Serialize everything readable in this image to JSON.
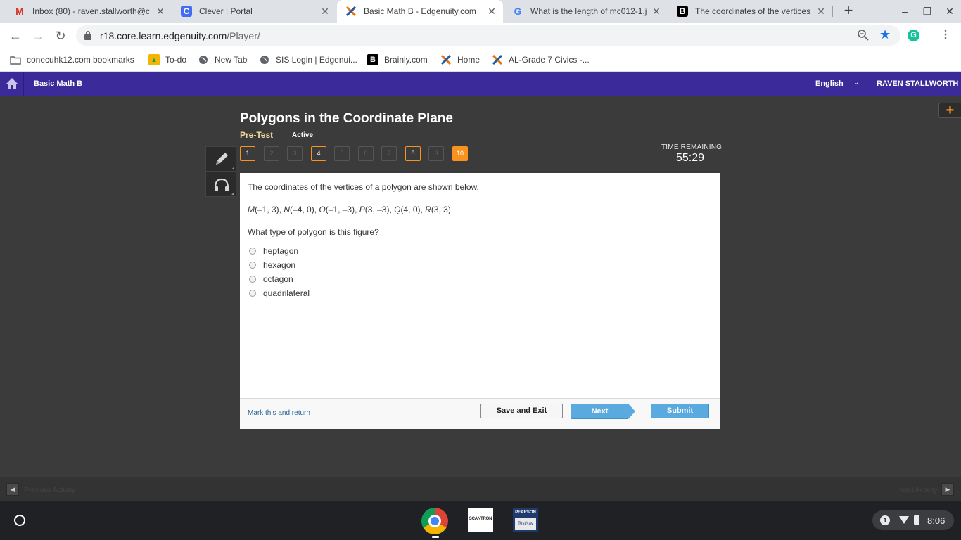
{
  "browser": {
    "tabs": [
      {
        "title": "Inbox (80) - raven.stallworth@c",
        "favicon": "gmail-icon",
        "color": "#d93025",
        "active": false
      },
      {
        "title": "Clever | Portal",
        "favicon": "clever-icon",
        "color": "#436cf2",
        "active": false
      },
      {
        "title": "Basic Math B - Edgenuity.com",
        "favicon": "edgenuity-icon",
        "color": "#e8710a",
        "active": true
      },
      {
        "title": "What is the length of mc012-1.j",
        "favicon": "google-icon",
        "color": "#4285f4",
        "active": false
      },
      {
        "title": "The coordinates of the vertices c",
        "favicon": "brainly-icon",
        "color": "#000000",
        "active": false
      }
    ],
    "url_host": "r18.core.learn.edgenuity.com",
    "url_path": "/Player/",
    "bookmarks": [
      {
        "label": "conecuhk12.com bookmarks",
        "icon": "folder-icon"
      },
      {
        "label": "To-do",
        "icon": "todo-icon"
      },
      {
        "label": "New Tab",
        "icon": "globe-icon"
      },
      {
        "label": "SIS Login | Edgenui...",
        "icon": "globe-icon"
      },
      {
        "label": "Brainly.com",
        "icon": "brainly-icon"
      },
      {
        "label": "Home",
        "icon": "edgenuity-icon"
      },
      {
        "label": "AL-Grade 7 Civics -...",
        "icon": "edgenuity-icon"
      }
    ]
  },
  "header": {
    "course": "Basic Math B",
    "language": "English",
    "user": "RAVEN STALLWORTH",
    "bg_color": "#3b2a99"
  },
  "lesson": {
    "title": "Polygons in the Coordinate Plane",
    "activity_type": "Pre-Test",
    "status": "Active",
    "timer_label": "TIME REMAINING",
    "timer": "55:29"
  },
  "question_nav": [
    {
      "label": "1",
      "state": "answered"
    },
    {
      "label": "2",
      "state": "unanswered"
    },
    {
      "label": "3",
      "state": "unanswered"
    },
    {
      "label": "4",
      "state": "answered"
    },
    {
      "label": "5",
      "state": "unanswered"
    },
    {
      "label": "6",
      "state": "unanswered"
    },
    {
      "label": "7",
      "state": "unanswered"
    },
    {
      "label": "8",
      "state": "answered"
    },
    {
      "label": "9",
      "state": "unanswered"
    },
    {
      "label": "10",
      "state": "current"
    }
  ],
  "question": {
    "stem": "The coordinates of the vertices of a polygon are shown below.",
    "points": [
      {
        "name": "M",
        "coords": "(–1, 3)"
      },
      {
        "name": "N",
        "coords": "(–4, 0)"
      },
      {
        "name": "O",
        "coords": "(–1, –3)"
      },
      {
        "name": "P",
        "coords": "(3, –3)"
      },
      {
        "name": "Q",
        "coords": "(4, 0)"
      },
      {
        "name": "R",
        "coords": "(3, 3)"
      }
    ],
    "prompt": "What type of polygon is this figure?",
    "choices": [
      "heptagon",
      "hexagon",
      "octagon",
      "quadrilateral"
    ]
  },
  "footer": {
    "mark_link": "Mark this and return",
    "save": "Save and Exit",
    "next": "Next",
    "submit": "Submit"
  },
  "activity_nav": {
    "prev": "Previous Activity",
    "next": "Next Activity"
  },
  "shelf": {
    "apps": [
      "chrome-icon",
      "scantron-icon",
      "testnav-icon"
    ],
    "scantron_label": "SCANTRON",
    "testnav_top": "PEARSON",
    "testnav_bottom": "TestNav",
    "notification_count": "1",
    "time": "8:06"
  },
  "accent_color": "#f7931e"
}
